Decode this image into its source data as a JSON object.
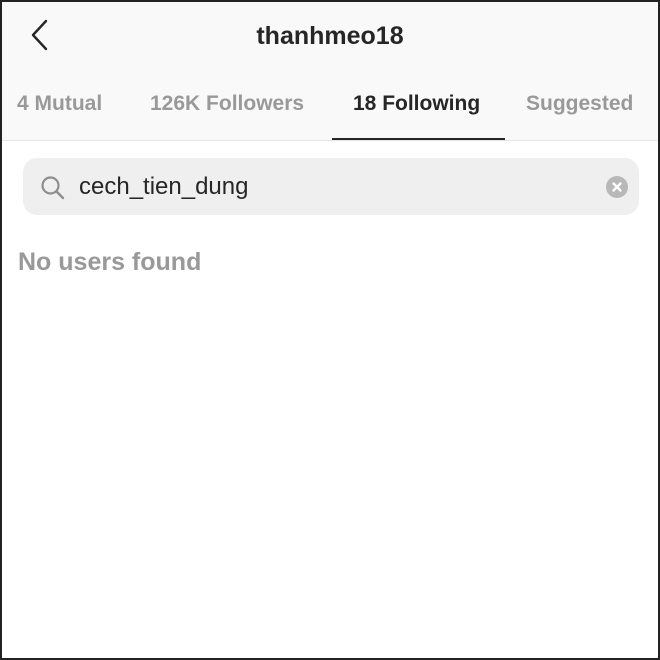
{
  "header": {
    "title": "thanhmeo18",
    "back_icon": "chevron-left-icon"
  },
  "tabs": [
    {
      "label": "4 Mutual",
      "active": false
    },
    {
      "label": "126K Followers",
      "active": false
    },
    {
      "label": "18 Following",
      "active": true
    },
    {
      "label": "Suggested",
      "active": false
    }
  ],
  "search": {
    "value": "cech_tien_dung",
    "icon": "search-icon",
    "clear_icon": "clear-icon"
  },
  "results": {
    "empty_message": "No users found"
  }
}
